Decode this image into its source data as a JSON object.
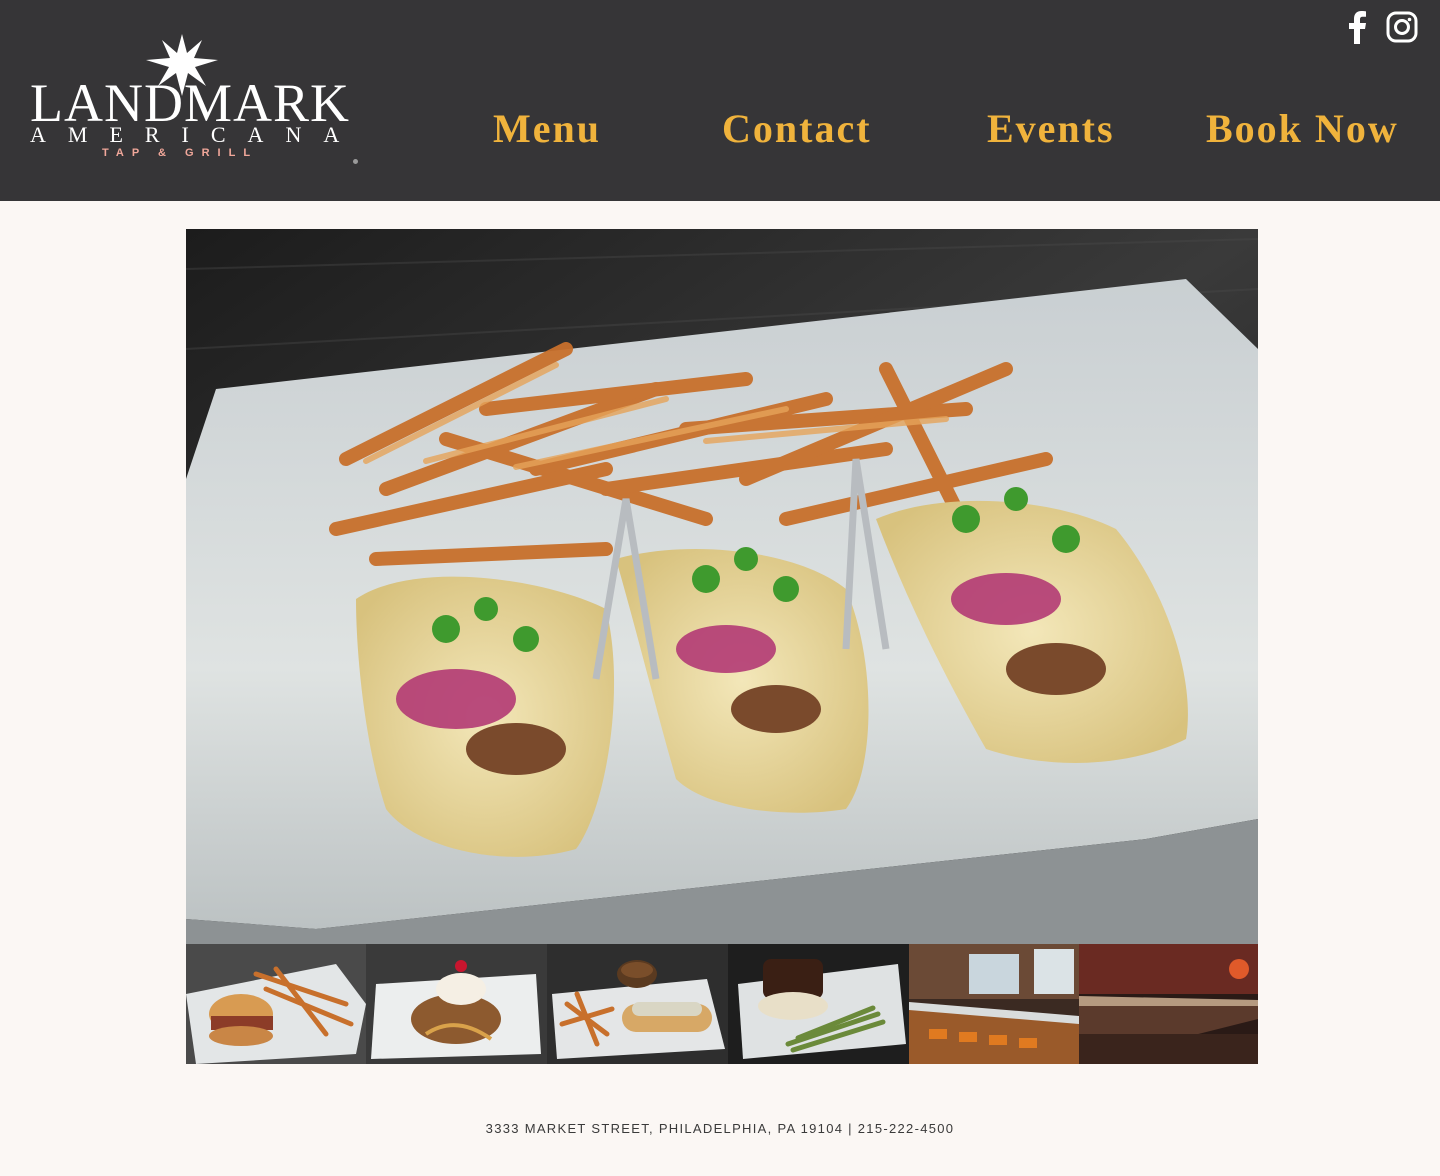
{
  "brand": {
    "name_line1": "LANDMARK",
    "name_line2": "AMERICANA",
    "tagline": "TAP & GRILL"
  },
  "social": {
    "facebook_icon": "facebook-icon",
    "instagram_icon": "instagram-icon"
  },
  "nav": {
    "items": [
      {
        "label": "Menu"
      },
      {
        "label": "Contact"
      },
      {
        "label": "Events"
      },
      {
        "label": "Book Now"
      }
    ]
  },
  "gallery": {
    "hero": {
      "subject": "tacos with fries on white plate"
    },
    "thumbnails": [
      {
        "subject": "sandwich with fries"
      },
      {
        "subject": "dessert with ice cream and cherry"
      },
      {
        "subject": "sandwich with au jus and fries"
      },
      {
        "subject": "braised short rib with asparagus"
      },
      {
        "subject": "bar counter with orange stools"
      },
      {
        "subject": "long bar with red lighting"
      }
    ]
  },
  "footer": {
    "text": "3333 MARKET STREET, PHILADELPHIA, PA 19104 | 215-222-4500"
  },
  "colors": {
    "header_bg": "#363537",
    "nav_text": "#f0b33c",
    "page_bg": "#fbf7f4",
    "tagline": "#f1a79a"
  }
}
